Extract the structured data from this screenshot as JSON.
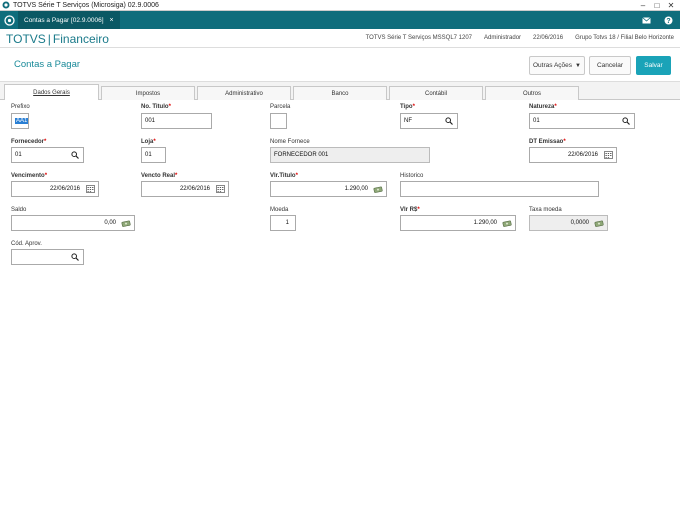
{
  "window": {
    "title": "TOTVS Série T Serviços (Microsiga) 02.9.0006",
    "minimize": "–",
    "maximize": "□",
    "close": "✕"
  },
  "tabs": {
    "doc_tab_label": "Contas a Pagar [02.9.0006]",
    "doc_tab_close": "×"
  },
  "brand": {
    "name": "TOTVS",
    "separator": "|",
    "module": "Financeiro"
  },
  "sysinfo": {
    "system": "TOTVS Série T Serviços MSSQL7 1207",
    "user": "Administrador",
    "date": "22/06/2016",
    "branch": "Grupo Totvs 18 / Filial Belo Horizonte"
  },
  "header": {
    "title": "Contas a Pagar",
    "more_actions": "Outras Ações",
    "cancel": "Cancelar",
    "save": "Salvar"
  },
  "folders": [
    "Dados Gerais",
    "Impostos",
    "Administrativo",
    "Banco",
    "Contábil",
    "Outros"
  ],
  "form": {
    "prefixo": {
      "label": "Prefixo",
      "value": "AA1"
    },
    "no_titulo": {
      "label": "No. Titulo",
      "value": "001"
    },
    "parcela": {
      "label": "Parcela",
      "value": ""
    },
    "tipo": {
      "label": "Tipo",
      "value": "NF"
    },
    "natureza": {
      "label": "Natureza",
      "value": "01"
    },
    "fornecedor": {
      "label": "Fornecedor",
      "value": "01"
    },
    "loja": {
      "label": "Loja",
      "value": "01"
    },
    "nome_fornece": {
      "label": "Nome Fornece",
      "value": "FORNECEDOR 001"
    },
    "dt_emissao": {
      "label": "DT Emissao",
      "value": "22/06/2016"
    },
    "vencimento": {
      "label": "Vencimento",
      "value": "22/06/2016"
    },
    "vencto_real": {
      "label": "Vencto Real",
      "value": "22/06/2016"
    },
    "vlr_titulo": {
      "label": "Vlr.Titulo",
      "value": "1.290,00"
    },
    "historico": {
      "label": "Historico",
      "value": ""
    },
    "saldo": {
      "label": "Saldo",
      "value": "0,00"
    },
    "moeda": {
      "label": "Moeda",
      "value": "1"
    },
    "vlr_rs": {
      "label": "Vlr R$",
      "value": "1.290,00"
    },
    "taxa_moeda": {
      "label": "Taxa moeda",
      "value": "0,0000"
    },
    "cod_aprov": {
      "label": "Cód. Aprov.",
      "value": ""
    },
    "required_mark": "*"
  },
  "colors": {
    "tabstrip": "#0f6d7c",
    "brand": "#1a7a8a",
    "accent": "#1aa3b8",
    "required": "#dd0000"
  }
}
